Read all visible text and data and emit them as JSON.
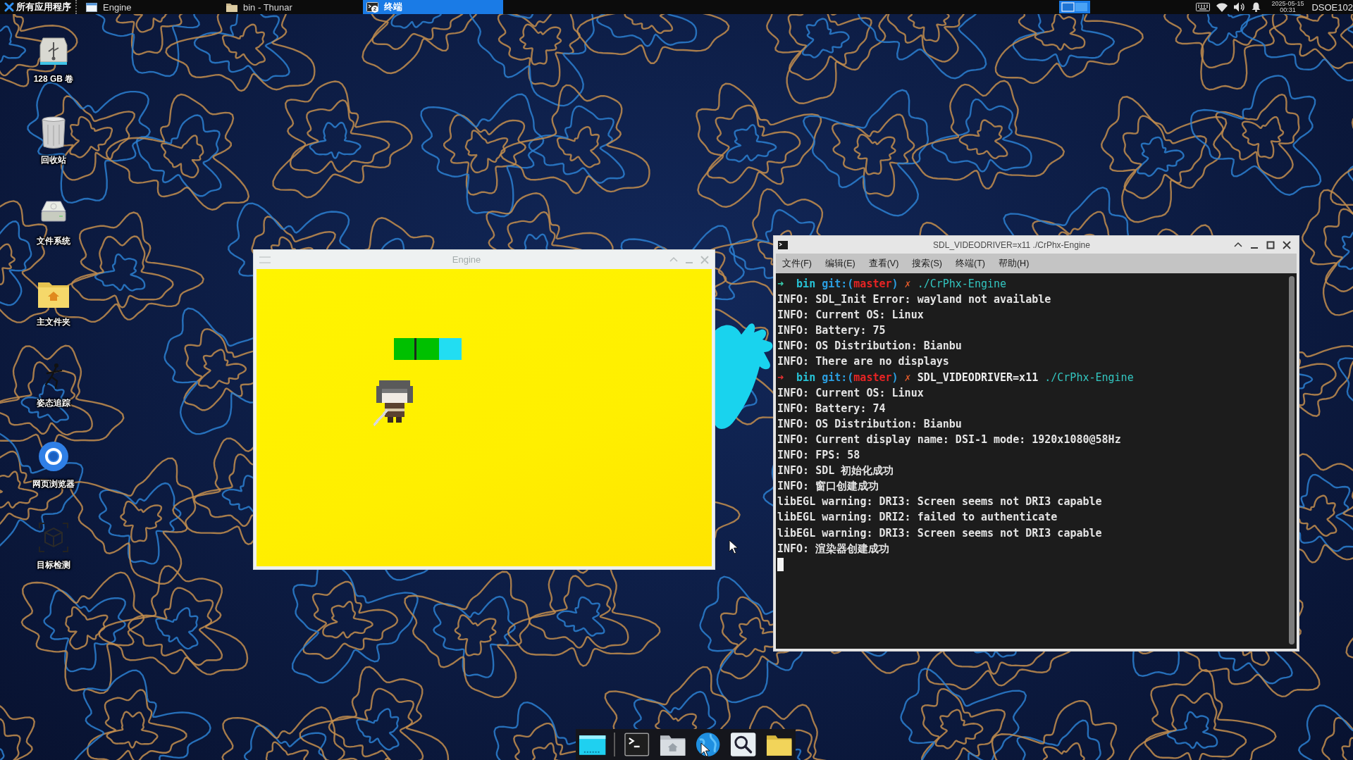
{
  "top_panel": {
    "app_menu": "所有应用程序",
    "tasks": [
      {
        "label": "Engine",
        "kind": "window",
        "selected": false
      },
      {
        "label": "bin - Thunar",
        "kind": "folder",
        "selected": false
      },
      {
        "label": "终端",
        "kind": "terminal",
        "selected": true,
        "count": "2"
      }
    ],
    "clock": {
      "date": "2025-05-15",
      "time": "00:31"
    },
    "hostname": "DSOE102"
  },
  "desktop_icons": [
    {
      "label": "128 GB 卷",
      "kind": "usb"
    },
    {
      "label": "回收站",
      "kind": "trash"
    },
    {
      "label": "文件系统",
      "kind": "drive"
    },
    {
      "label": "主文件夹",
      "kind": "home"
    },
    {
      "label": "姿态追踪",
      "kind": "pose"
    },
    {
      "label": "网页浏览器",
      "kind": "browser"
    },
    {
      "label": "目标检测",
      "kind": "detect"
    }
  ],
  "engine_window": {
    "title": "Engine",
    "tiles": [
      {
        "color": "#00c000"
      },
      {
        "color": "#00c000"
      },
      {
        "color": "#22ddf2"
      }
    ]
  },
  "terminal_window": {
    "title": "SDL_VIDEODRIVER=x11 ./CrPhx-Engine",
    "menu": [
      "文件(F)",
      "编辑(E)",
      "查看(V)",
      "搜索(S)",
      "终端(T)",
      "帮助(H)"
    ],
    "lines": [
      {
        "kind": "prompt",
        "failed": false,
        "arrow": "➜",
        "dir": "bin",
        "git_prefix": "git:(",
        "branch": "master",
        "git_suffix": ")",
        "dirty": "✗",
        "command": [
          {
            "kind": "program",
            "text": "./CrPhx-Engine"
          }
        ]
      },
      {
        "kind": "output",
        "text": "INFO: SDL_Init Error: wayland not available"
      },
      {
        "kind": "output",
        "text": "INFO: Current OS: Linux"
      },
      {
        "kind": "output",
        "text": "INFO: Battery: 75"
      },
      {
        "kind": "output",
        "text": "INFO: OS Distribution: Bianbu"
      },
      {
        "kind": "output",
        "text": "INFO: There are no displays"
      },
      {
        "kind": "prompt",
        "failed": true,
        "arrow": "➜",
        "dir": "bin",
        "git_prefix": "git:(",
        "branch": "master",
        "git_suffix": ")",
        "dirty": "✗",
        "command": [
          {
            "kind": "env",
            "text": "SDL_VIDEODRIVER=x11"
          },
          {
            "kind": "program",
            "text": "./CrPhx-Engine"
          }
        ]
      },
      {
        "kind": "output",
        "text": "INFO: Current OS: Linux"
      },
      {
        "kind": "output",
        "text": "INFO: Battery: 74"
      },
      {
        "kind": "output",
        "text": "INFO: OS Distribution: Bianbu"
      },
      {
        "kind": "output",
        "text": "INFO: Current display name: DSI-1 mode: 1920x1080@58Hz"
      },
      {
        "kind": "output",
        "text": "INFO: FPS: 58"
      },
      {
        "kind": "output",
        "text": "INFO: SDL 初始化成功"
      },
      {
        "kind": "output",
        "text": "INFO: 窗口创建成功"
      },
      {
        "kind": "output",
        "text": "libEGL warning: DRI3: Screen seems not DRI3 capable"
      },
      {
        "kind": "output",
        "text": "libEGL warning: DRI2: failed to authenticate"
      },
      {
        "kind": "output",
        "text": "libEGL warning: DRI3: Screen seems not DRI3 capable"
      },
      {
        "kind": "output",
        "text": "INFO: 渲染器创建成功"
      }
    ]
  }
}
